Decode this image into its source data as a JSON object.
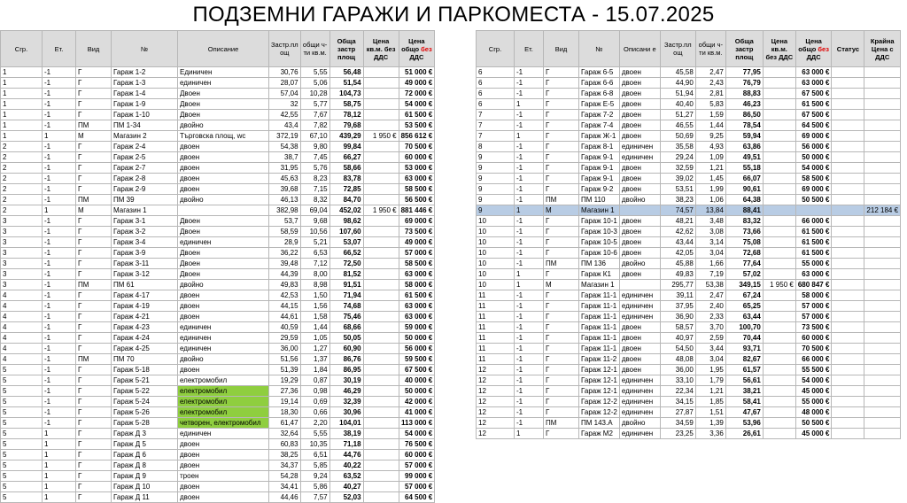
{
  "title": "ПОДЗЕМНИ ГАРАЖИ И ПАРКОМЕСТА  - 15.07.2025",
  "headers_left": [
    "Сгр.",
    "Ет.",
    "Вид",
    "№",
    "Описание",
    "Застр.пл ощ",
    "общи ч-ти кв.м.",
    "Обща застр площ",
    "Цена кв.м. без ДДС",
    "Цена общо без ДДС"
  ],
  "headers_right": [
    "Сгр.",
    "Ет.",
    "Вид",
    "№",
    "Описани е",
    "Застр.пл ощ",
    "общи ч-ти кв.м.",
    "Обща застр площ",
    "Цена кв.м. без ДДС",
    "Цена общо без ДДС",
    "Статус",
    "Крайна Цена с ДДС"
  ],
  "header_red_word": "без",
  "left_rows": [
    [
      "1",
      "-1",
      "Г",
      "Гараж 1-2",
      "Единичен",
      "30,76",
      "5,55",
      "56,48",
      "",
      "51 000 €"
    ],
    [
      "1",
      "-1",
      "Г",
      "Гараж 1-3",
      "единичен",
      "28,07",
      "5,06",
      "51,54",
      "",
      "49 000 €"
    ],
    [
      "1",
      "-1",
      "Г",
      "Гараж 1-4",
      "Двоен",
      "57,04",
      "10,28",
      "104,73",
      "",
      "72 000 €"
    ],
    [
      "1",
      "-1",
      "Г",
      "Гараж 1-9",
      "Двоен",
      "32",
      "5,77",
      "58,75",
      "",
      "54 000 €"
    ],
    [
      "1",
      "-1",
      "Г",
      "Гараж 1-10",
      "Двоен",
      "42,55",
      "7,67",
      "78,12",
      "",
      "61 500 €"
    ],
    [
      "1",
      "-1",
      "ПМ",
      "ПМ 1-34",
      "двойно",
      "43,4",
      "7,82",
      "79,68",
      "",
      "53 500 €"
    ],
    [
      "1",
      "1",
      "М",
      "Магазин 2",
      "Търговска площ, wc",
      "372,19",
      "67,10",
      "439,29",
      "1 950 €",
      "856 612 €"
    ],
    [
      "2",
      "-1",
      "Г",
      "Гараж 2-4",
      "двоен",
      "54,38",
      "9,80",
      "99,84",
      "",
      "70 500 €"
    ],
    [
      "2",
      "-1",
      "Г",
      "Гараж 2-5",
      "двоен",
      "38,7",
      "7,45",
      "66,27",
      "",
      "60 000 €"
    ],
    [
      "2",
      "-1",
      "Г",
      "Гараж 2-7",
      "двоен",
      "31,95",
      "5,76",
      "58,66",
      "",
      "53 000 €"
    ],
    [
      "2",
      "-1",
      "Г",
      "Гараж 2-8",
      "двоен",
      "45,63",
      "8,23",
      "83,78",
      "",
      "63 000 €"
    ],
    [
      "2",
      "-1",
      "Г",
      "Гараж 2-9",
      "двоен",
      "39,68",
      "7,15",
      "72,85",
      "",
      "58 500 €"
    ],
    [
      "2",
      "-1",
      "ПМ",
      "ПМ 39",
      "двойно",
      "46,13",
      "8,32",
      "84,70",
      "",
      "56 500 €"
    ],
    [
      "2",
      "1",
      "М",
      "Магазин 1",
      "",
      "382,98",
      "69,04",
      "452,02",
      "1 950 €",
      "881 446 €"
    ],
    [
      "3",
      "-1",
      "Г",
      "Гараж 3-1",
      "Двоен",
      "53,7",
      "9,68",
      "98,62",
      "",
      "69 000 €"
    ],
    [
      "3",
      "-1",
      "Г",
      "Гараж 3-2",
      "Двоен",
      "58,59",
      "10,56",
      "107,60",
      "",
      "73 500 €"
    ],
    [
      "3",
      "-1",
      "Г",
      "Гараж 3-4",
      "единичен",
      "28,9",
      "5,21",
      "53,07",
      "",
      "49 000 €"
    ],
    [
      "3",
      "-1",
      "Г",
      "Гараж 3-9",
      "Двоен",
      "36,22",
      "6,53",
      "66,52",
      "",
      "57 000 €"
    ],
    [
      "3",
      "-1",
      "Г",
      "Гараж 3-11",
      "Двоен",
      "39,48",
      "7,12",
      "72,50",
      "",
      "58 500 €"
    ],
    [
      "3",
      "-1",
      "Г",
      "Гараж 3-12",
      "Двоен",
      "44,39",
      "8,00",
      "81,52",
      "",
      "63 000 €"
    ],
    [
      "3",
      "-1",
      "ПМ",
      "ПМ 61",
      "двойно",
      "49,83",
      "8,98",
      "91,51",
      "",
      "58 000 €"
    ],
    [
      "4",
      "-1",
      "Г",
      "Гараж 4-17",
      "двоен",
      "42,53",
      "1,50",
      "71,94",
      "",
      "61 500 €"
    ],
    [
      "4",
      "-1",
      "Г",
      "Гараж 4-19",
      "двоен",
      "44,15",
      "1,56",
      "74,68",
      "",
      "63 000 €"
    ],
    [
      "4",
      "-1",
      "Г",
      "Гараж 4-21",
      "двоен",
      "44,61",
      "1,58",
      "75,46",
      "",
      "63 000 €"
    ],
    [
      "4",
      "-1",
      "Г",
      "Гараж 4-23",
      "единичен",
      "40,59",
      "1,44",
      "68,66",
      "",
      "59 000 €"
    ],
    [
      "4",
      "-1",
      "Г",
      "Гараж 4-24",
      "единичен",
      "29,59",
      "1,05",
      "50,05",
      "",
      "50 000 €"
    ],
    [
      "4",
      "-1",
      "Г",
      "Гараж 4-25",
      "единичен",
      "36,00",
      "1,27",
      "60,90",
      "",
      "56 000 €"
    ],
    [
      "4",
      "-1",
      "ПМ",
      "ПМ 70",
      "двойно",
      "51,56",
      "1,37",
      "86,76",
      "",
      "59 500 €"
    ],
    [
      "5",
      "-1",
      "Г",
      "Гараж 5-18",
      "двоен",
      "51,39",
      "1,84",
      "86,95",
      "",
      "67 500 €"
    ],
    [
      "5",
      "-1",
      "Г",
      "Гараж 5-21",
      "електромобил",
      "19,29",
      "0,87",
      "30,19",
      "",
      "40 000 €"
    ],
    [
      "5",
      "-1",
      "Г",
      "Гараж 5-22",
      "електромобил",
      "27,36",
      "0,98",
      "46,29",
      "",
      "50 000 €"
    ],
    [
      "5",
      "-1",
      "Г",
      "Гараж 5-24",
      "електромобил",
      "19,14",
      "0,69",
      "32,39",
      "",
      "42 000 €"
    ],
    [
      "5",
      "-1",
      "Г",
      "Гараж 5-26",
      "електромобил",
      "18,30",
      "0,66",
      "30,96",
      "",
      "41 000 €"
    ],
    [
      "5",
      "-1",
      "Г",
      "Гараж 5-28",
      "четворен, електромобил",
      "61,47",
      "2,20",
      "104,01",
      "",
      "113 000 €"
    ],
    [
      "5",
      "1",
      "Г",
      "Гараж Д 3",
      "единичен",
      "32,64",
      "5,55",
      "38,19",
      "",
      "54 000 €"
    ],
    [
      "5",
      "1",
      "Г",
      "Гараж Д 5",
      "двоен",
      "60,83",
      "10,35",
      "71,18",
      "",
      "76 500 €"
    ],
    [
      "5",
      "1",
      "Г",
      "Гараж Д 6",
      "двоен",
      "38,25",
      "6,51",
      "44,76",
      "",
      "60 000 €"
    ],
    [
      "5",
      "1",
      "Г",
      "Гараж Д 8",
      "двоен",
      "34,37",
      "5,85",
      "40,22",
      "",
      "57 000 €"
    ],
    [
      "5",
      "1",
      "Г",
      "Гараж Д 9",
      "троен",
      "54,28",
      "9,24",
      "63,52",
      "",
      "99 000 €"
    ],
    [
      "5",
      "1",
      "Г",
      "Гараж Д 10",
      "двоен",
      "34,41",
      "5,86",
      "40,27",
      "",
      "57 000 €"
    ],
    [
      "5",
      "1",
      "Г",
      "Гараж Д 11",
      "двоен",
      "44,46",
      "7,57",
      "52,03",
      "",
      "64 500 €"
    ]
  ],
  "left_green_rows": [
    30,
    31,
    32,
    33
  ],
  "right_rows": [
    [
      "6",
      "-1",
      "Г",
      "Гараж 6-5",
      "двоен",
      "45,58",
      "2,47",
      "77,95",
      "",
      "63 000 €",
      "",
      ""
    ],
    [
      "6",
      "-1",
      "Г",
      "Гараж 6-6",
      "двоен",
      "44,90",
      "2,43",
      "76,79",
      "",
      "63 000 €",
      "",
      ""
    ],
    [
      "6",
      "-1",
      "Г",
      "Гараж 6-8",
      "двоен",
      "51,94",
      "2,81",
      "88,83",
      "",
      "67 500 €",
      "",
      ""
    ],
    [
      "6",
      "1",
      "Г",
      "Гараж Е-5",
      "двоен",
      "40,40",
      "5,83",
      "46,23",
      "",
      "61 500 €",
      "",
      ""
    ],
    [
      "7",
      "-1",
      "Г",
      "Гараж 7-2",
      "двоен",
      "51,27",
      "1,59",
      "86,50",
      "",
      "67 500 €",
      "",
      ""
    ],
    [
      "7",
      "-1",
      "Г",
      "Гараж 7-4",
      "двоен",
      "46,55",
      "1,44",
      "78,54",
      "",
      "64 500 €",
      "",
      ""
    ],
    [
      "7",
      "1",
      "Г",
      "Гараж Ж-1",
      "двоен",
      "50,69",
      "9,25",
      "59,94",
      "",
      "69 000 €",
      "",
      ""
    ],
    [
      "8",
      "-1",
      "Г",
      "Гараж 8-1",
      "единичен",
      "35,58",
      "4,93",
      "63,86",
      "",
      "56 000 €",
      "",
      ""
    ],
    [
      "9",
      "-1",
      "Г",
      "Гараж 9-1",
      "единичен",
      "29,24",
      "1,09",
      "49,51",
      "",
      "50 000 €",
      "",
      ""
    ],
    [
      "9",
      "-1",
      "Г",
      "Гараж 9-1",
      "двоен",
      "32,59",
      "1,21",
      "55,18",
      "",
      "54 000 €",
      "",
      ""
    ],
    [
      "9",
      "-1",
      "Г",
      "Гараж 9-1",
      "двоен",
      "39,02",
      "1,45",
      "66,07",
      "",
      "58 500 €",
      "",
      ""
    ],
    [
      "9",
      "-1",
      "Г",
      "Гараж 9-2",
      "двоен",
      "53,51",
      "1,99",
      "90,61",
      "",
      "69 000 €",
      "",
      ""
    ],
    [
      "9",
      "-1",
      "ПМ",
      "ПМ 110",
      "двойно",
      "38,23",
      "1,06",
      "64,38",
      "",
      "50 500 €",
      "",
      ""
    ],
    [
      "9",
      "1",
      "М",
      "Магазин 1",
      "",
      "74,57",
      "13,84",
      "88,41",
      "",
      "",
      "",
      "212 184 €"
    ],
    [
      "10",
      "-1",
      "Г",
      "Гараж 10-1",
      "двоен",
      "48,21",
      "3,48",
      "83,32",
      "",
      "66 000 €",
      "",
      ""
    ],
    [
      "10",
      "-1",
      "Г",
      "Гараж 10-3",
      "двоен",
      "42,62",
      "3,08",
      "73,66",
      "",
      "61 500 €",
      "",
      ""
    ],
    [
      "10",
      "-1",
      "Г",
      "Гараж 10-5",
      "двоен",
      "43,44",
      "3,14",
      "75,08",
      "",
      "61 500 €",
      "",
      ""
    ],
    [
      "10",
      "-1",
      "Г",
      "Гараж 10-6",
      "двоен",
      "42,05",
      "3,04",
      "72,68",
      "",
      "61 500 €",
      "",
      ""
    ],
    [
      "10",
      "-1",
      "ПМ",
      "ПМ 136",
      "двойно",
      "45,88",
      "1,66",
      "77,64",
      "",
      "55 000 €",
      "",
      ""
    ],
    [
      "10",
      "1",
      "Г",
      "Гараж К1",
      "двоен",
      "49,83",
      "7,19",
      "57,02",
      "",
      "63 000 €",
      "",
      ""
    ],
    [
      "10",
      "1",
      "М",
      "Магазин 1",
      "",
      "295,77",
      "53,38",
      "349,15",
      "1 950 €",
      "680 847 €",
      "",
      ""
    ],
    [
      "11",
      "-1",
      "Г",
      "Гараж 11-1",
      "единичен",
      "39,11",
      "2,47",
      "67,24",
      "",
      "58 000 €",
      "",
      ""
    ],
    [
      "11",
      "-1",
      "Г",
      "Гараж 11-1",
      "единичен",
      "37,95",
      "2,40",
      "65,25",
      "",
      "57 000 €",
      "",
      ""
    ],
    [
      "11",
      "-1",
      "Г",
      "Гараж 11-1",
      "единичен",
      "36,90",
      "2,33",
      "63,44",
      "",
      "57 000 €",
      "",
      ""
    ],
    [
      "11",
      "-1",
      "Г",
      "Гараж 11-1",
      "двоен",
      "58,57",
      "3,70",
      "100,70",
      "",
      "73 500 €",
      "",
      ""
    ],
    [
      "11",
      "-1",
      "Г",
      "Гараж 11-1",
      "двоен",
      "40,97",
      "2,59",
      "70,44",
      "",
      "60 000 €",
      "",
      ""
    ],
    [
      "11",
      "-1",
      "Г",
      "Гараж 11-1",
      "двоен",
      "54,50",
      "3,44",
      "93,71",
      "",
      "70 500 €",
      "",
      ""
    ],
    [
      "11",
      "-1",
      "Г",
      "Гараж 11-2",
      "двоен",
      "48,08",
      "3,04",
      "82,67",
      "",
      "66 000 €",
      "",
      ""
    ],
    [
      "12",
      "-1",
      "Г",
      "Гараж 12-1",
      "двоен",
      "36,00",
      "1,95",
      "61,57",
      "",
      "55 500 €",
      "",
      ""
    ],
    [
      "12",
      "-1",
      "Г",
      "Гараж 12-1",
      "единичен",
      "33,10",
      "1,79",
      "56,61",
      "",
      "54 000 €",
      "",
      ""
    ],
    [
      "12",
      "-1",
      "Г",
      "Гараж 12-1",
      "единичен",
      "22,34",
      "1,21",
      "38,21",
      "",
      "45 000 €",
      "",
      ""
    ],
    [
      "12",
      "-1",
      "Г",
      "Гараж 12-2",
      "единичен",
      "34,15",
      "1,85",
      "58,41",
      "",
      "55 000 €",
      "",
      ""
    ],
    [
      "12",
      "-1",
      "Г",
      "Гараж 12-2",
      "единичен",
      "27,87",
      "1,51",
      "47,67",
      "",
      "48 000 €",
      "",
      ""
    ],
    [
      "12",
      "-1",
      "ПМ",
      "ПМ 143.А",
      "двойно",
      "34,59",
      "1,39",
      "53,96",
      "",
      "50 500 €",
      "",
      ""
    ],
    [
      "12",
      "1",
      "Г",
      "Гараж М2",
      "единичен",
      "23,25",
      "3,36",
      "26,61",
      "",
      "45 000 €",
      "",
      ""
    ]
  ],
  "right_highlight_row": 13
}
